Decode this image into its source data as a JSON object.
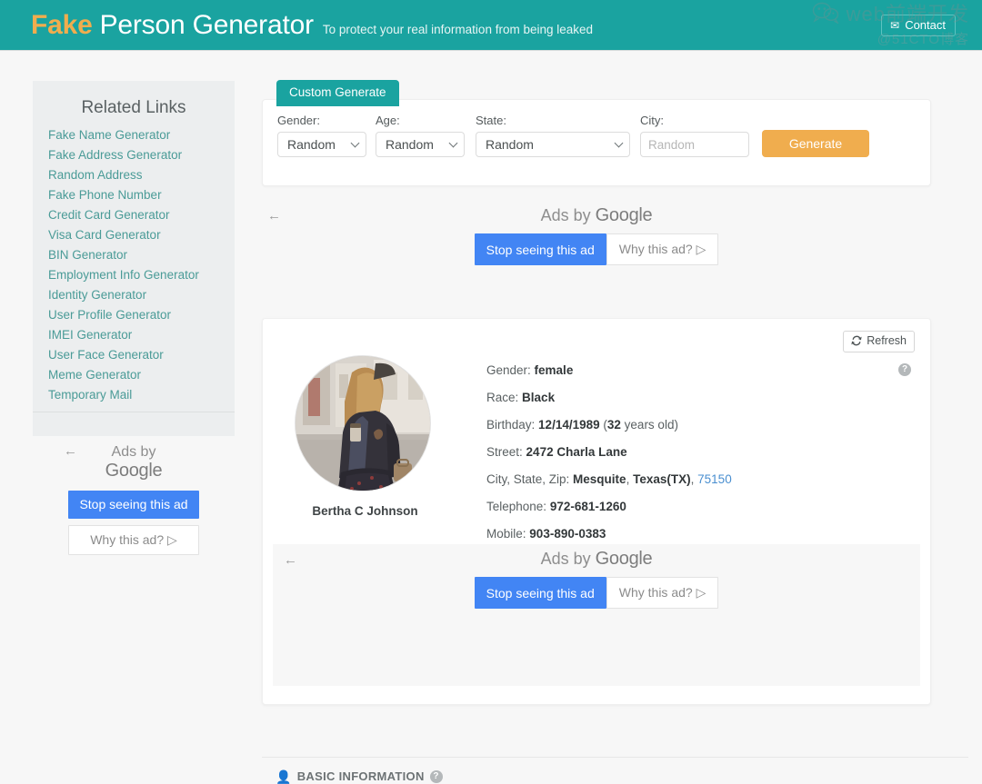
{
  "header": {
    "brand_accent": "Fake",
    "brand_rest": "Person Generator",
    "tagline": "To protect your real information from being leaked",
    "contact_label": "Contact",
    "contact_icon": "envelope-icon",
    "bg_color": "#1aa3a0",
    "accent_color": "#f0ad4e"
  },
  "sidebar": {
    "title": "Related Links",
    "links": [
      {
        "label": "Fake Name Generator"
      },
      {
        "label": "Fake Address Generator"
      },
      {
        "label": "Random Address"
      },
      {
        "label": "Fake Phone Number"
      },
      {
        "label": "Credit Card Generator"
      },
      {
        "label": "Visa Card Generator"
      },
      {
        "label": "BIN Generator"
      },
      {
        "label": "Employment Info Generator"
      },
      {
        "label": "Identity Generator"
      },
      {
        "label": "User Profile Generator"
      },
      {
        "label": "IMEI Generator"
      },
      {
        "label": "User Face Generator"
      },
      {
        "label": "Meme Generator"
      },
      {
        "label": "Temporary Mail"
      }
    ],
    "ad": {
      "back_arrow": "←",
      "ads_by": "Ads by",
      "google": "Google",
      "stop_label": "Stop seeing this ad",
      "why_label": "Why this ad? ▷"
    }
  },
  "form": {
    "tab_label": "Custom Generate",
    "gender": {
      "label": "Gender:",
      "value": "Random"
    },
    "age": {
      "label": "Age:",
      "value": "Random"
    },
    "state": {
      "label": "State:",
      "value": "Random"
    },
    "city": {
      "label": "City:",
      "placeholder": "Random",
      "value": ""
    },
    "generate_label": "Generate"
  },
  "top_ad": {
    "back_arrow": "←",
    "ads_by": "Ads by",
    "google": "Google",
    "stop_label": "Stop seeing this ad",
    "why_label": "Why this ad? ▷"
  },
  "inner_ad": {
    "back_arrow": "←",
    "ads_by": "Ads by",
    "google": "Google",
    "stop_label": "Stop seeing this ad",
    "why_label": "Why this ad? ▷"
  },
  "result": {
    "refresh_label": "Refresh",
    "refresh_icon": "refresh-icon",
    "help_icon": "question-circle-icon",
    "avatar_icon": "user-photo",
    "name": "Bertha C Johnson",
    "fields": {
      "gender_label": "Gender:",
      "gender_value": "female",
      "race_label": "Race:",
      "race_value": "Black",
      "birthday_label": "Birthday:",
      "birthday_value": "12/14/1989",
      "birthday_age": "(32 years old)",
      "birthday_age_num": "32",
      "birthday_age_suffix": " years old)",
      "street_label": "Street:",
      "street_value": "2472 Charla Lane",
      "csz_label": "City, State, Zip:",
      "csz_city": "Mesquite",
      "csz_state": "Texas(TX)",
      "csz_zip": "75150",
      "telephone_label": "Telephone:",
      "telephone_value": "972-681-1260",
      "mobile_label": "Mobile:",
      "mobile_value": "903-890-0383"
    }
  },
  "basic_information": {
    "icon": "person-icon",
    "title": "BASIC INFORMATION",
    "help_icon": "question-circle-icon"
  },
  "watermark": {
    "icon": "wechat-icon",
    "line1": "web前端开发",
    "line2": "@51CTO博客"
  }
}
